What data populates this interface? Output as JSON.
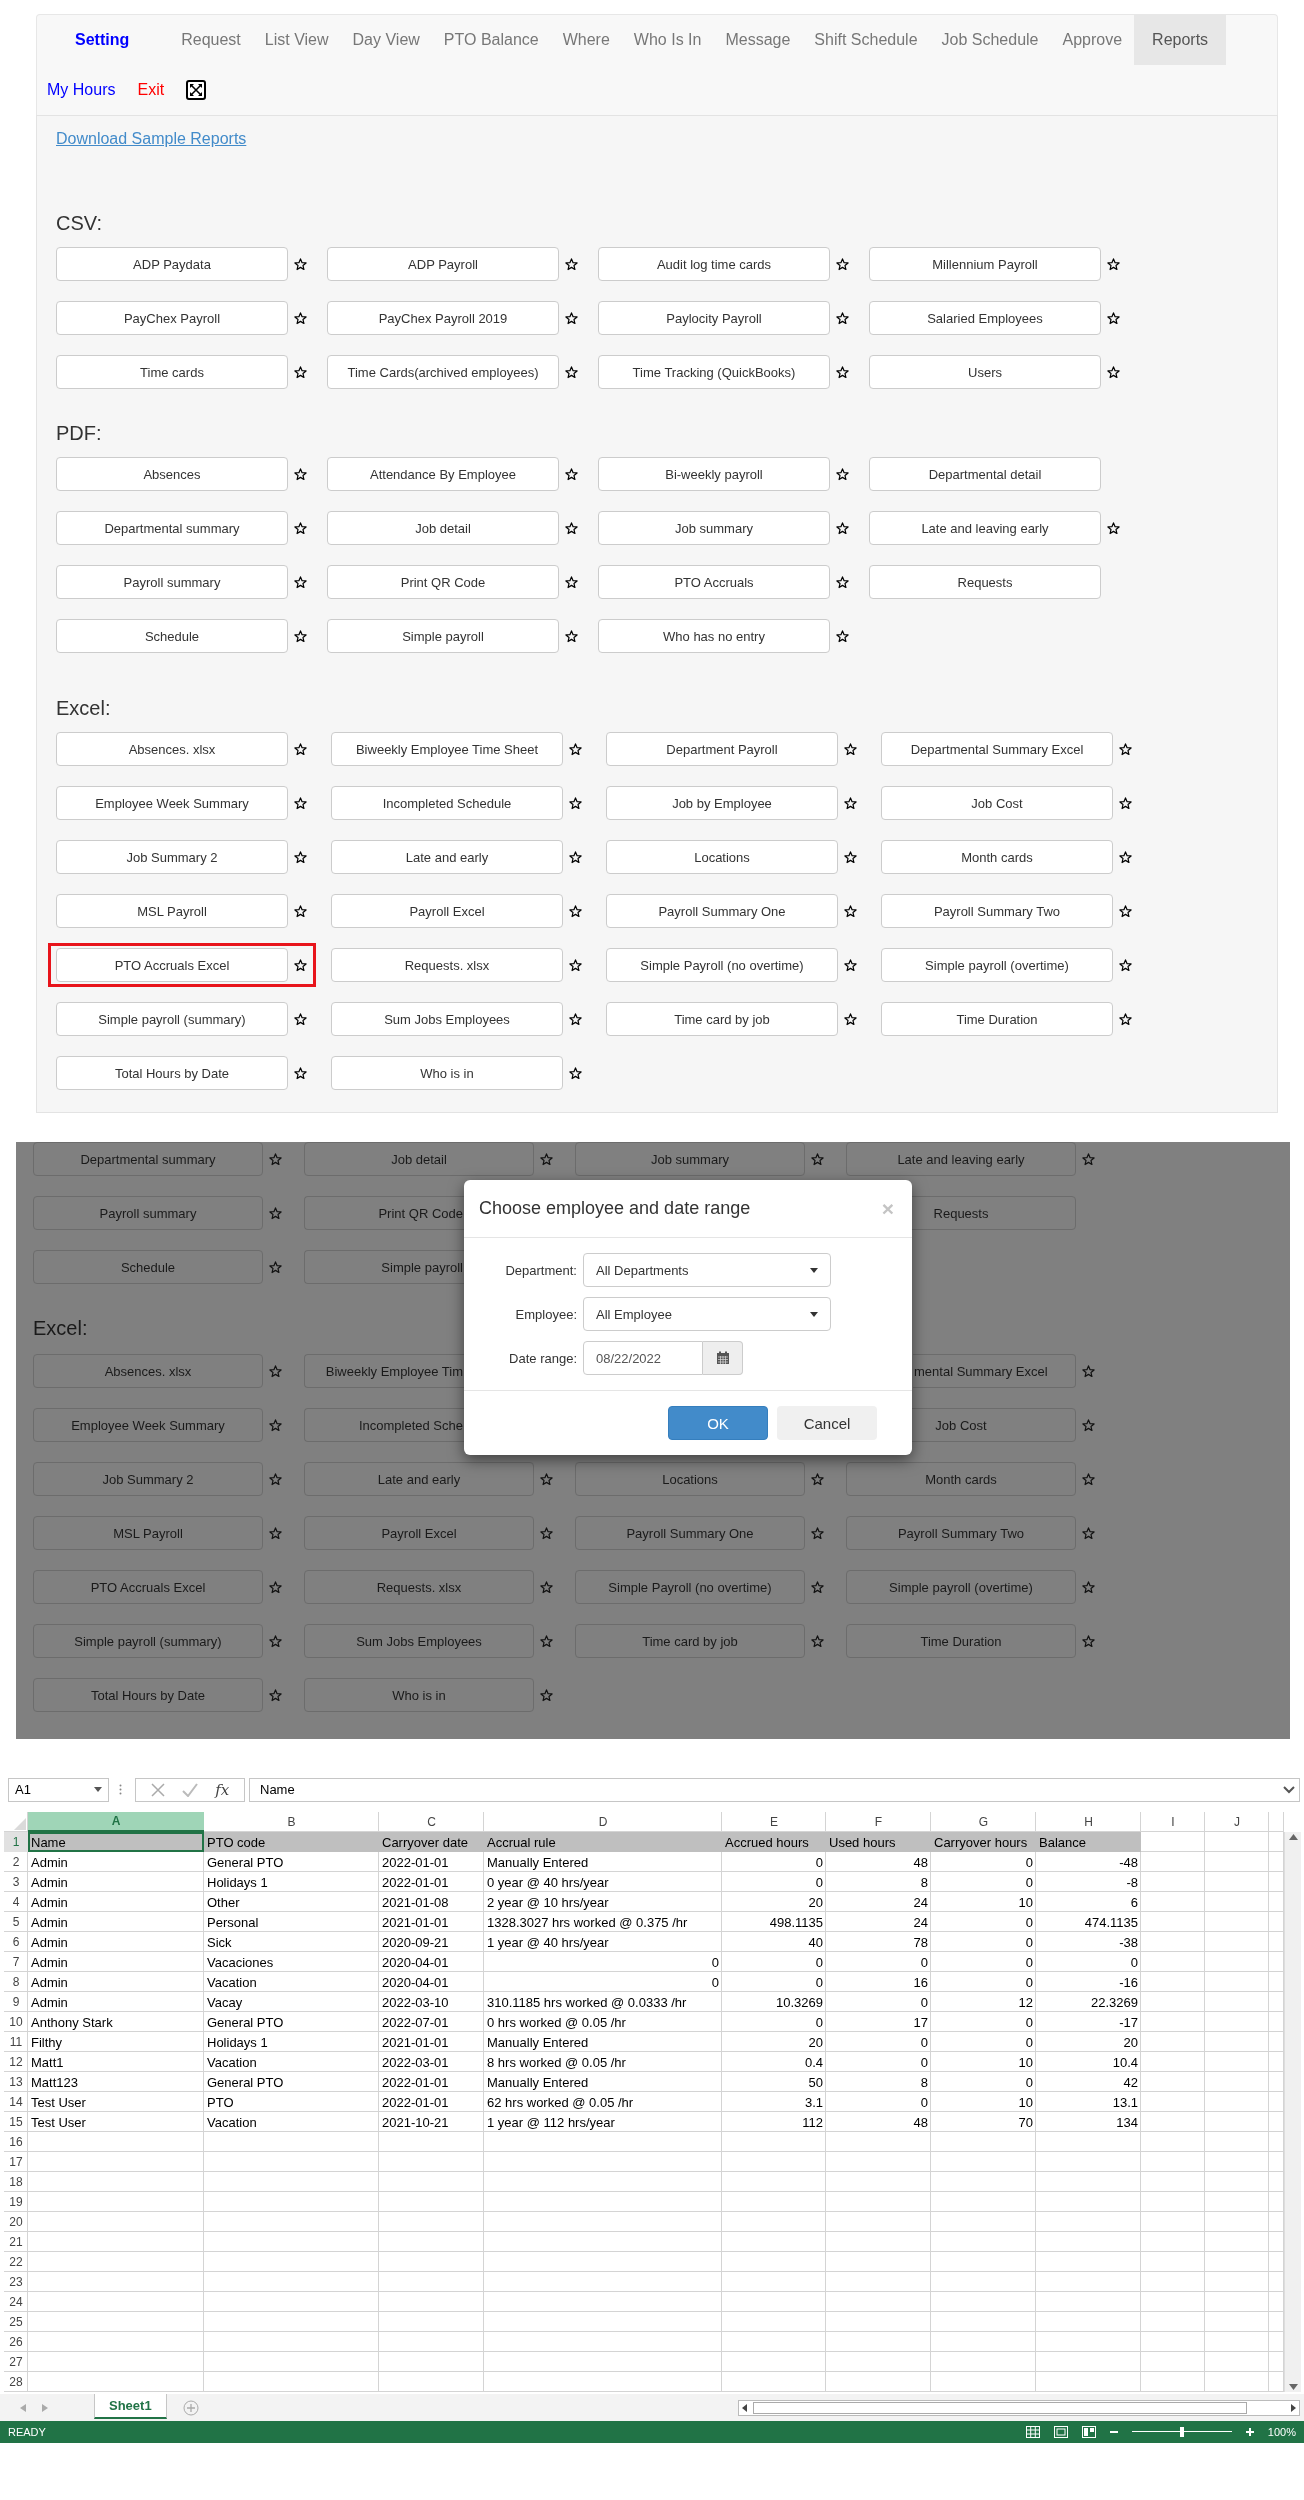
{
  "nav": {
    "brand": "Setting",
    "tabs": [
      {
        "label": "Request",
        "selected": false
      },
      {
        "label": "List View",
        "selected": false
      },
      {
        "label": "Day View",
        "selected": false
      },
      {
        "label": "PTO Balance",
        "selected": false
      },
      {
        "label": "Where",
        "selected": false
      },
      {
        "label": "Who Is In",
        "selected": false
      },
      {
        "label": "Message",
        "selected": false
      },
      {
        "label": "Shift Schedule",
        "selected": false
      },
      {
        "label": "Job Schedule",
        "selected": false
      },
      {
        "label": "Approve",
        "selected": false
      },
      {
        "label": "Reports",
        "selected": true
      }
    ],
    "links": [
      {
        "label": "My Hours",
        "color": "#0000ff"
      },
      {
        "label": "Exit",
        "color": "#ff0000"
      }
    ]
  },
  "reports": {
    "download_link": "Download Sample Reports",
    "sections": [
      {
        "heading": "CSV:",
        "items": [
          {
            "label": "ADP Paydata",
            "star": true,
            "highlighted": false
          },
          {
            "label": "ADP Payroll",
            "star": true,
            "highlighted": false
          },
          {
            "label": "Audit log time cards",
            "star": true,
            "highlighted": false
          },
          {
            "label": "Millennium Payroll",
            "star": true,
            "highlighted": false
          },
          {
            "label": "PayChex Payroll",
            "star": true,
            "highlighted": false
          },
          {
            "label": "PayChex Payroll 2019",
            "star": true,
            "highlighted": false
          },
          {
            "label": "Paylocity Payroll",
            "star": true,
            "highlighted": false
          },
          {
            "label": "Salaried Employees",
            "star": true,
            "highlighted": false
          },
          {
            "label": "Time cards",
            "star": true,
            "highlighted": false
          },
          {
            "label": "Time Cards(archived employees)",
            "star": true,
            "highlighted": false
          },
          {
            "label": "Time Tracking (QuickBooks)",
            "star": true,
            "highlighted": false
          },
          {
            "label": "Users",
            "star": true,
            "highlighted": false
          }
        ]
      },
      {
        "heading": "PDF:",
        "items": [
          {
            "label": "Absences",
            "star": true,
            "highlighted": false
          },
          {
            "label": "Attendance By Employee",
            "star": true,
            "highlighted": false
          },
          {
            "label": "Bi-weekly payroll",
            "star": true,
            "highlighted": false
          },
          {
            "label": "Departmental detail",
            "star": false,
            "highlighted": false
          },
          {
            "label": "Departmental summary",
            "star": true,
            "highlighted": false
          },
          {
            "label": "Job detail",
            "star": true,
            "highlighted": false
          },
          {
            "label": "Job summary",
            "star": true,
            "highlighted": false
          },
          {
            "label": "Late and leaving early",
            "star": true,
            "highlighted": false
          },
          {
            "label": "Payroll summary",
            "star": true,
            "highlighted": false
          },
          {
            "label": "Print QR Code",
            "star": true,
            "highlighted": false
          },
          {
            "label": "PTO Accruals",
            "star": true,
            "highlighted": false
          },
          {
            "label": "Requests",
            "star": false,
            "highlighted": false
          },
          {
            "label": "Schedule",
            "star": true,
            "highlighted": false
          },
          {
            "label": "Simple payroll",
            "star": true,
            "highlighted": false
          },
          {
            "label": "Who has no entry",
            "star": true,
            "highlighted": false
          }
        ]
      },
      {
        "heading": "Excel:",
        "items": [
          {
            "label": "Absences. xlsx",
            "star": true,
            "highlighted": false
          },
          {
            "label": "Biweekly Employee Time Sheet",
            "star": true,
            "highlighted": false
          },
          {
            "label": "Department Payroll",
            "star": true,
            "highlighted": false
          },
          {
            "label": "Departmental Summary Excel",
            "star": true,
            "highlighted": false
          },
          {
            "label": "Employee Week Summary",
            "star": true,
            "highlighted": false
          },
          {
            "label": "Incompleted Schedule",
            "star": true,
            "highlighted": false
          },
          {
            "label": "Job by Employee",
            "star": true,
            "highlighted": false
          },
          {
            "label": "Job Cost",
            "star": true,
            "highlighted": false
          },
          {
            "label": "Job Summary 2",
            "star": true,
            "highlighted": false
          },
          {
            "label": "Late and early",
            "star": true,
            "highlighted": false
          },
          {
            "label": "Locations",
            "star": true,
            "highlighted": false
          },
          {
            "label": "Month cards",
            "star": true,
            "highlighted": false
          },
          {
            "label": "MSL Payroll",
            "star": true,
            "highlighted": false
          },
          {
            "label": "Payroll Excel",
            "star": true,
            "highlighted": false
          },
          {
            "label": "Payroll Summary One",
            "star": true,
            "highlighted": false
          },
          {
            "label": "Payroll Summary Two",
            "star": true,
            "highlighted": false
          },
          {
            "label": "PTO Accruals Excel",
            "star": true,
            "highlighted": true
          },
          {
            "label": "Requests. xlsx",
            "star": true,
            "highlighted": false
          },
          {
            "label": "Simple Payroll (no overtime)",
            "star": true,
            "highlighted": false
          },
          {
            "label": "Simple payroll (overtime)",
            "star": true,
            "highlighted": false
          },
          {
            "label": "Simple payroll (summary)",
            "star": true,
            "highlighted": false
          },
          {
            "label": "Sum Jobs Employees",
            "star": true,
            "highlighted": false
          },
          {
            "label": "Time card by job",
            "star": true,
            "highlighted": false
          },
          {
            "label": "Time Duration",
            "star": true,
            "highlighted": false
          },
          {
            "label": "Total Hours by Date",
            "star": true,
            "highlighted": false
          },
          {
            "label": "Who is in",
            "star": true,
            "highlighted": false
          }
        ]
      }
    ]
  },
  "dimmed_page": {
    "blocks": [
      {
        "kind": "row",
        "cells": [
          {
            "label": "Departmental summary",
            "kind": "whole",
            "star": true
          },
          {
            "label": "Job detail",
            "kind": "whole",
            "star": true
          },
          {
            "label": "Job summary",
            "kind": "whole",
            "star": true
          },
          {
            "label": "Late and leaving early",
            "kind": "whole",
            "star": true
          }
        ]
      },
      {
        "kind": "row",
        "cells": [
          {
            "label": "Payroll summary",
            "kind": "whole",
            "star": true
          },
          {
            "label": "Print QR Code",
            "kind": "covered_right",
            "star": false
          },
          null,
          {
            "label": "Requests",
            "kind": "whole",
            "star": false
          }
        ]
      },
      {
        "kind": "row",
        "cells": [
          {
            "label": "Schedule",
            "kind": "whole",
            "star": true
          },
          {
            "label": "Simple payroll",
            "kind": "covered_right",
            "star": false
          },
          null,
          null
        ]
      },
      {
        "kind": "heading",
        "text": "Excel:"
      },
      {
        "kind": "row",
        "cells": [
          {
            "label": "Absences. xlsx",
            "kind": "whole",
            "star": true
          },
          {
            "label": "Biweekly Employee Tim",
            "kind": "covered_right",
            "star": false
          },
          null,
          {
            "label": "mental Summary Excel",
            "kind": "covered_left",
            "star": true
          }
        ]
      },
      {
        "kind": "row",
        "cells": [
          {
            "label": "Employee Week Summary",
            "kind": "whole",
            "star": true
          },
          {
            "label": "Incompleted Sche",
            "kind": "covered_right",
            "star": false
          },
          null,
          {
            "label": "Job Cost",
            "kind": "whole",
            "star": true
          }
        ]
      },
      {
        "kind": "row",
        "cells": [
          {
            "label": "Job Summary 2",
            "kind": "whole",
            "star": true
          },
          {
            "label": "Late and early",
            "kind": "whole",
            "star": true
          },
          {
            "label": "Locations",
            "kind": "whole",
            "star": true
          },
          {
            "label": "Month cards",
            "kind": "whole",
            "star": true
          }
        ]
      },
      {
        "kind": "row",
        "cells": [
          {
            "label": "MSL Payroll",
            "kind": "whole",
            "star": true
          },
          {
            "label": "Payroll Excel",
            "kind": "whole",
            "star": true
          },
          {
            "label": "Payroll Summary One",
            "kind": "whole",
            "star": true
          },
          {
            "label": "Payroll Summary Two",
            "kind": "whole",
            "star": true
          }
        ]
      },
      {
        "kind": "row",
        "cells": [
          {
            "label": "PTO Accruals Excel",
            "kind": "whole",
            "star": true
          },
          {
            "label": "Requests. xlsx",
            "kind": "whole",
            "star": true
          },
          {
            "label": "Simple Payroll (no overtime)",
            "kind": "whole",
            "star": true
          },
          {
            "label": "Simple payroll (overtime)",
            "kind": "whole",
            "star": true
          }
        ]
      },
      {
        "kind": "row",
        "cells": [
          {
            "label": "Simple payroll (summary)",
            "kind": "whole",
            "star": true
          },
          {
            "label": "Sum Jobs Employees",
            "kind": "whole",
            "star": true
          },
          {
            "label": "Time card by job",
            "kind": "whole",
            "star": true
          },
          {
            "label": "Time Duration",
            "kind": "whole",
            "star": true
          }
        ]
      },
      {
        "kind": "row",
        "cells": [
          {
            "label": "Total Hours by Date",
            "kind": "whole",
            "star": true
          },
          {
            "label": "Who is in",
            "kind": "whole",
            "star": true
          },
          null,
          null
        ]
      }
    ]
  },
  "dialog": {
    "title": "Choose employee and date range",
    "close": "×",
    "fields": [
      {
        "kind": "select",
        "label": "Department:",
        "value": "All Departments"
      },
      {
        "kind": "select",
        "label": "Employee:",
        "value": "All Employee"
      },
      {
        "kind": "date",
        "label": "Date range:",
        "value": "08/22/2022"
      }
    ],
    "buttons": [
      {
        "kind": "primary",
        "label": "OK"
      },
      {
        "kind": "default",
        "label": "Cancel"
      }
    ]
  },
  "spreadsheet": {
    "name_box": "A1",
    "function_label": "fx",
    "formula": "Name",
    "columns": [
      {
        "letter": "A",
        "kind": "text",
        "selected": true
      },
      {
        "letter": "B",
        "kind": "text",
        "selected": false
      },
      {
        "letter": "C",
        "kind": "text",
        "selected": false
      },
      {
        "letter": "D",
        "kind": "text",
        "selected": false
      },
      {
        "letter": "E",
        "kind": "number",
        "selected": false
      },
      {
        "letter": "F",
        "kind": "number",
        "selected": false
      },
      {
        "letter": "G",
        "kind": "number",
        "selected": false
      },
      {
        "letter": "H",
        "kind": "number",
        "selected": false
      },
      {
        "letter": "I",
        "kind": "text",
        "selected": false
      },
      {
        "letter": "J",
        "kind": "text",
        "selected": false
      }
    ],
    "header": [
      "Name",
      "PTO code",
      "Carryover date",
      "Accrual rule",
      "Accrued hours",
      "Used hours",
      "Carryover hours",
      "Balance"
    ],
    "rows": [
      [
        "Admin",
        "General PTO",
        "2022-01-01",
        "Manually Entered",
        "0",
        "48",
        "0",
        "-48"
      ],
      [
        "Admin",
        "Holidays 1",
        "2022-01-01",
        "0 year @ 40 hrs/year",
        "0",
        "8",
        "0",
        "-8"
      ],
      [
        "Admin",
        "Other",
        "2021-01-08",
        "2 year @ 10 hrs/year",
        "20",
        "24",
        "10",
        "6"
      ],
      [
        "Admin",
        "Personal",
        "2021-01-01",
        "1328.3027 hrs worked @ 0.375 /hr",
        "498.1135",
        "24",
        "0",
        "474.1135"
      ],
      [
        "Admin",
        "Sick",
        "2020-09-21",
        "1 year @ 40 hrs/year",
        "40",
        "78",
        "0",
        "-38"
      ],
      [
        "Admin",
        "Vacaciones",
        "2020-04-01",
        {
          "text": "0",
          "kind": "number"
        },
        "0",
        "0",
        "0",
        "0"
      ],
      [
        "Admin",
        "Vacation",
        "2020-04-01",
        {
          "text": "0",
          "kind": "number"
        },
        "0",
        "16",
        "0",
        "-16"
      ],
      [
        "Admin",
        "Vacay",
        "2022-03-10",
        "310.1185 hrs worked @ 0.0333 /hr",
        "10.3269",
        "0",
        "12",
        "22.3269"
      ],
      [
        "Anthony Stark",
        "General PTO",
        "2022-07-01",
        "0 hrs worked @ 0.05 /hr",
        "0",
        "17",
        "0",
        "-17"
      ],
      [
        "Filthy",
        "Holidays 1",
        "2021-01-01",
        "Manually Entered",
        "20",
        "0",
        "0",
        "20"
      ],
      [
        "Matt1",
        "Vacation",
        "2022-03-01",
        "8 hrs worked @ 0.05 /hr",
        "0.4",
        "0",
        "10",
        "10.4"
      ],
      [
        "Matt123",
        "General PTO",
        "2022-01-01",
        "Manually Entered",
        "50",
        "8",
        "0",
        "42"
      ],
      [
        "Test User",
        "PTO",
        "2022-01-01",
        "62 hrs worked @ 0.05 /hr",
        "3.1",
        "0",
        "10",
        "13.1"
      ],
      [
        "Test User",
        "Vacation",
        "2021-10-21",
        "1 year @ 112 hrs/year",
        "112",
        "48",
        "70",
        "134"
      ]
    ],
    "row_numbers": [
      "1",
      "2",
      "3",
      "4",
      "5",
      "6",
      "7",
      "8",
      "9",
      "10",
      "11",
      "12",
      "13",
      "14",
      "15",
      "16",
      "17",
      "18",
      "19",
      "20",
      "21",
      "22",
      "23",
      "24",
      "25",
      "26",
      "27",
      "28"
    ],
    "sheets": [
      {
        "label": "Sheet1",
        "selected": true
      }
    ],
    "status": "READY",
    "zoom": {
      "level": 0.5,
      "label": "100%"
    }
  }
}
